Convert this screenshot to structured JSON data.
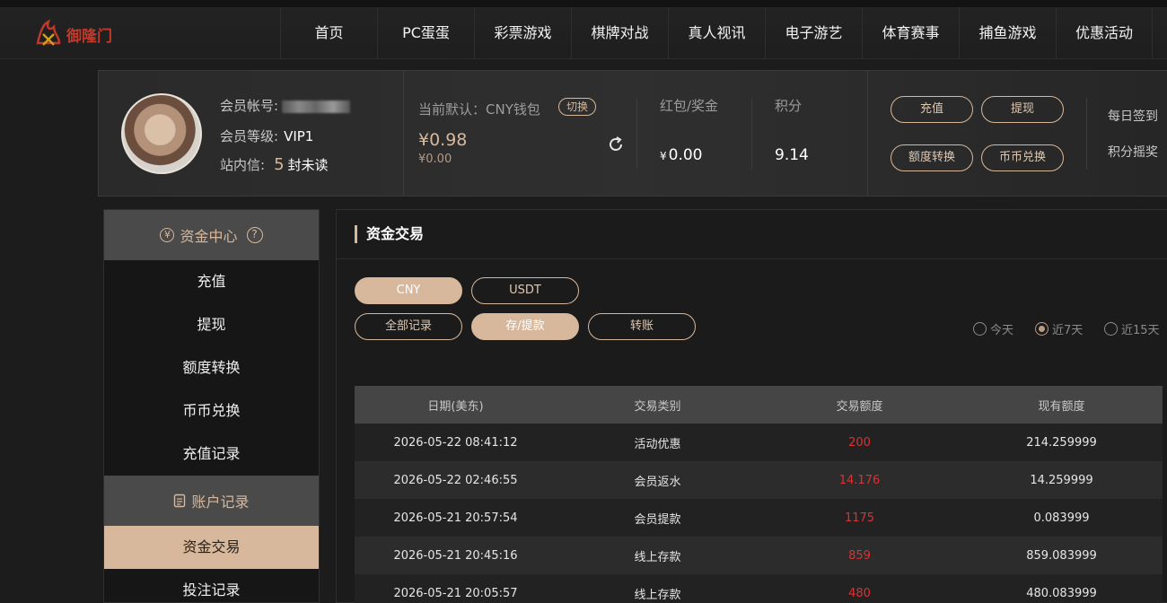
{
  "header": {
    "logo_text": "御隆门",
    "nav": [
      "首页",
      "PC蛋蛋",
      "彩票游戏",
      "棋牌对战",
      "真人视讯",
      "电子游艺",
      "体育赛事",
      "捕鱼游戏",
      "优惠活动"
    ]
  },
  "member": {
    "account_label": "会员帐号:",
    "level_label": "会员等级:",
    "level_value": "VIP1",
    "inbox_label": "站内信:",
    "inbox_count": "5",
    "inbox_suffix": "封未读",
    "wallet_label": "当前默认：CNY钱包",
    "switch_label": "切换",
    "balance_main": "¥0.98",
    "balance_sub": "¥0.00",
    "bonus_label": "红包/奖金",
    "bonus_currency": "¥",
    "bonus_value": "0.00",
    "points_label": "积分",
    "points_value": "9.14",
    "buttons": {
      "deposit": "充值",
      "withdraw": "提现",
      "transfer": "额度转换",
      "exchange": "币币兑换"
    },
    "links": {
      "daily_signin": "每日签到",
      "points_lottery": "积分摇奖"
    }
  },
  "sidebar": {
    "section1_title": "资金中心",
    "section1_items": [
      "充值",
      "提现",
      "额度转换",
      "币币兑换",
      "充值记录"
    ],
    "section2_title": "账户记录",
    "section2_items": [
      "资金交易",
      "投注记录"
    ]
  },
  "panel": {
    "title": "资金交易",
    "currency_tabs": [
      "CNY",
      "USDT"
    ],
    "record_tabs": [
      "全部记录",
      "存/提款",
      "转账"
    ],
    "ranges": [
      "今天",
      "近7天",
      "近15天"
    ],
    "selected_range": "近7天",
    "table": {
      "headers": [
        "日期(美东)",
        "交易类别",
        "交易额度",
        "现有额度"
      ],
      "rows": [
        [
          "2026-05-22 08:41:12",
          "活动优惠",
          "200",
          "214.259999"
        ],
        [
          "2026-05-22 02:46:55",
          "会员返水",
          "14.176",
          "14.259999"
        ],
        [
          "2026-05-21 20:57:54",
          "会员提款",
          "1175",
          "0.083999"
        ],
        [
          "2026-05-21 20:45:16",
          "线上存款",
          "859",
          "859.083999"
        ],
        [
          "2026-05-21 20:05:57",
          "线上存款",
          "480",
          "480.083999"
        ]
      ]
    }
  },
  "colors": {
    "accent": "#d7b89c",
    "amount_red": "#e03030",
    "background": "#1c1c1c"
  }
}
